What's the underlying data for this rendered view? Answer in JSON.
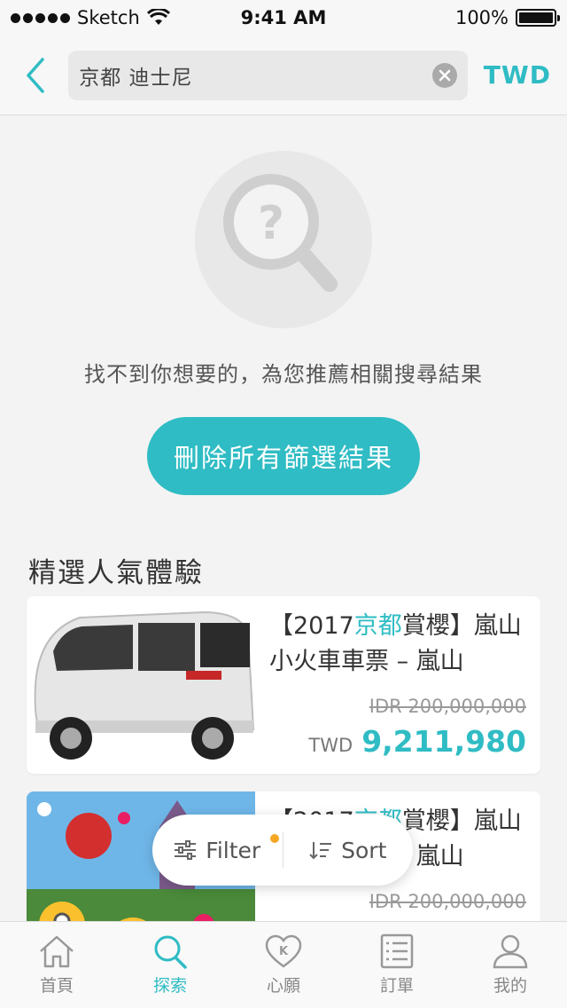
{
  "status": {
    "carrier": "Sketch",
    "time": "9:41 AM",
    "battery": "100%"
  },
  "header": {
    "search_value": "京都 迪士尼",
    "currency": "TWD"
  },
  "empty": {
    "message": "找不到你想要的，為您推薦相關搜尋結果",
    "clear_button": "刪除所有篩選結果"
  },
  "section": {
    "title": "精選人氣體驗"
  },
  "cards": [
    {
      "title_pre": "【2017",
      "title_hl": "京都",
      "title_post": "賞櫻】嵐山小火車車票 – 嵐山",
      "orig_price": "IDR 200,000,000",
      "currency": "TWD",
      "price": "9,211,980"
    },
    {
      "title_pre": "【2017",
      "title_hl": "京都",
      "title_post": "賞櫻】嵐山小火車車票 – 嵐山",
      "orig_price": "IDR 200,000,000"
    }
  ],
  "float_bar": {
    "filter": "Filter",
    "sort": "Sort"
  },
  "tabs": [
    {
      "label": "首頁",
      "icon": "home-icon"
    },
    {
      "label": "探索",
      "icon": "search-icon",
      "active": true
    },
    {
      "label": "心願",
      "icon": "heart-k-icon"
    },
    {
      "label": "訂單",
      "icon": "list-icon"
    },
    {
      "label": "我的",
      "icon": "user-icon"
    }
  ],
  "colors": {
    "accent": "#2fbcc4",
    "badge": "#f5a623"
  }
}
